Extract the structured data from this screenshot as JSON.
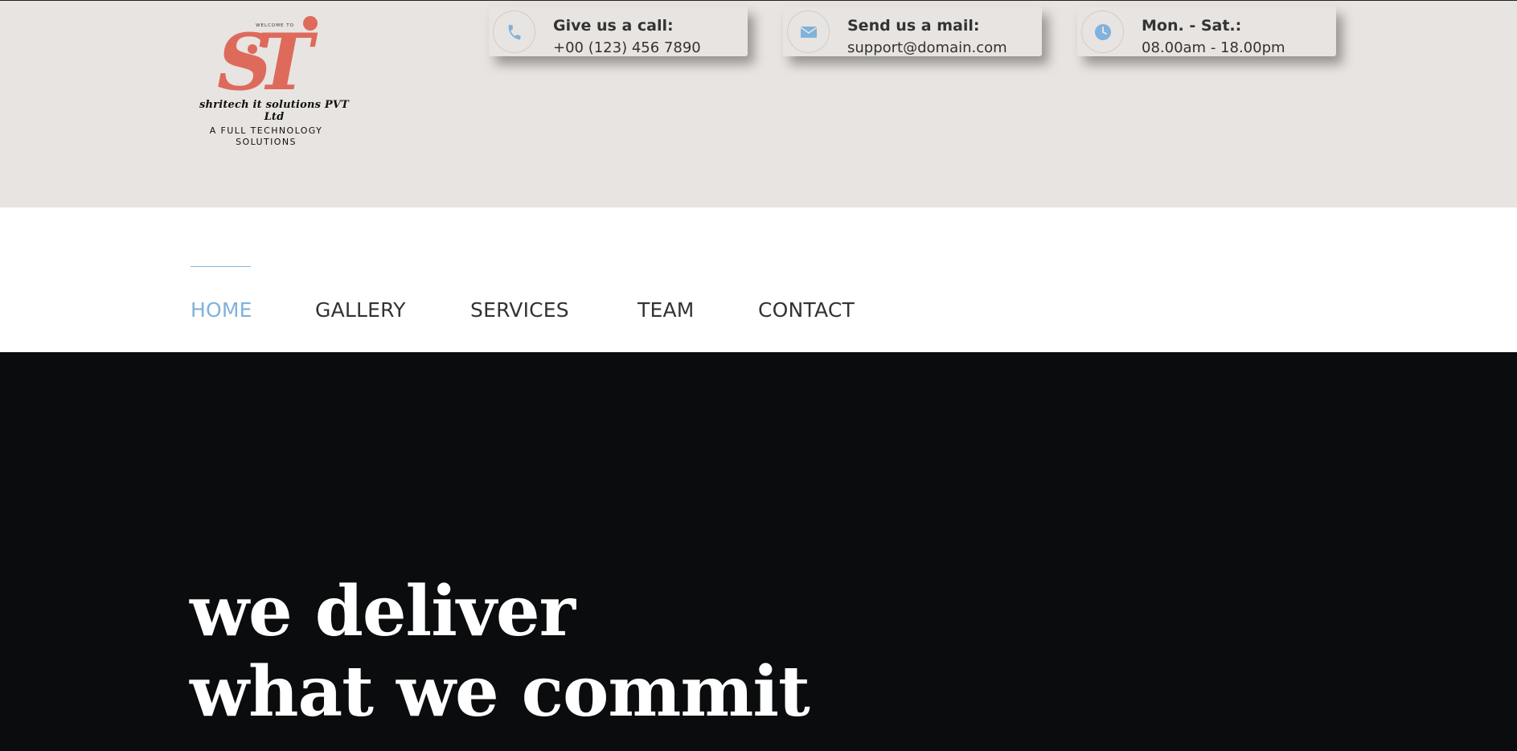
{
  "logo": {
    "welcome": "WELCOME TO",
    "mark": "ST",
    "company": "shritech it solutions PVT Ltd",
    "tagline_line1": "A FULL TECHNOLOGY",
    "tagline_line2": "SOLUTIONS",
    "brand_color": "#de6a5c"
  },
  "contact_cards": [
    {
      "icon": "phone-icon",
      "title": "Give us a call:",
      "value": "+00 (123) 456 7890"
    },
    {
      "icon": "envelope-icon",
      "title": "Send us a mail:",
      "value": "support@domain.com"
    },
    {
      "icon": "clock-icon",
      "title": "Mon. - Sat.:",
      "value": "08.00am - 18.00pm"
    }
  ],
  "nav": {
    "items": [
      "HOME",
      "GALLERY",
      "SERVICES",
      "TEAM",
      "CONTACT"
    ],
    "active": "HOME",
    "accent_color": "#7fb2dc"
  },
  "hero": {
    "line1": "we deliver",
    "line2": "what we commit"
  }
}
